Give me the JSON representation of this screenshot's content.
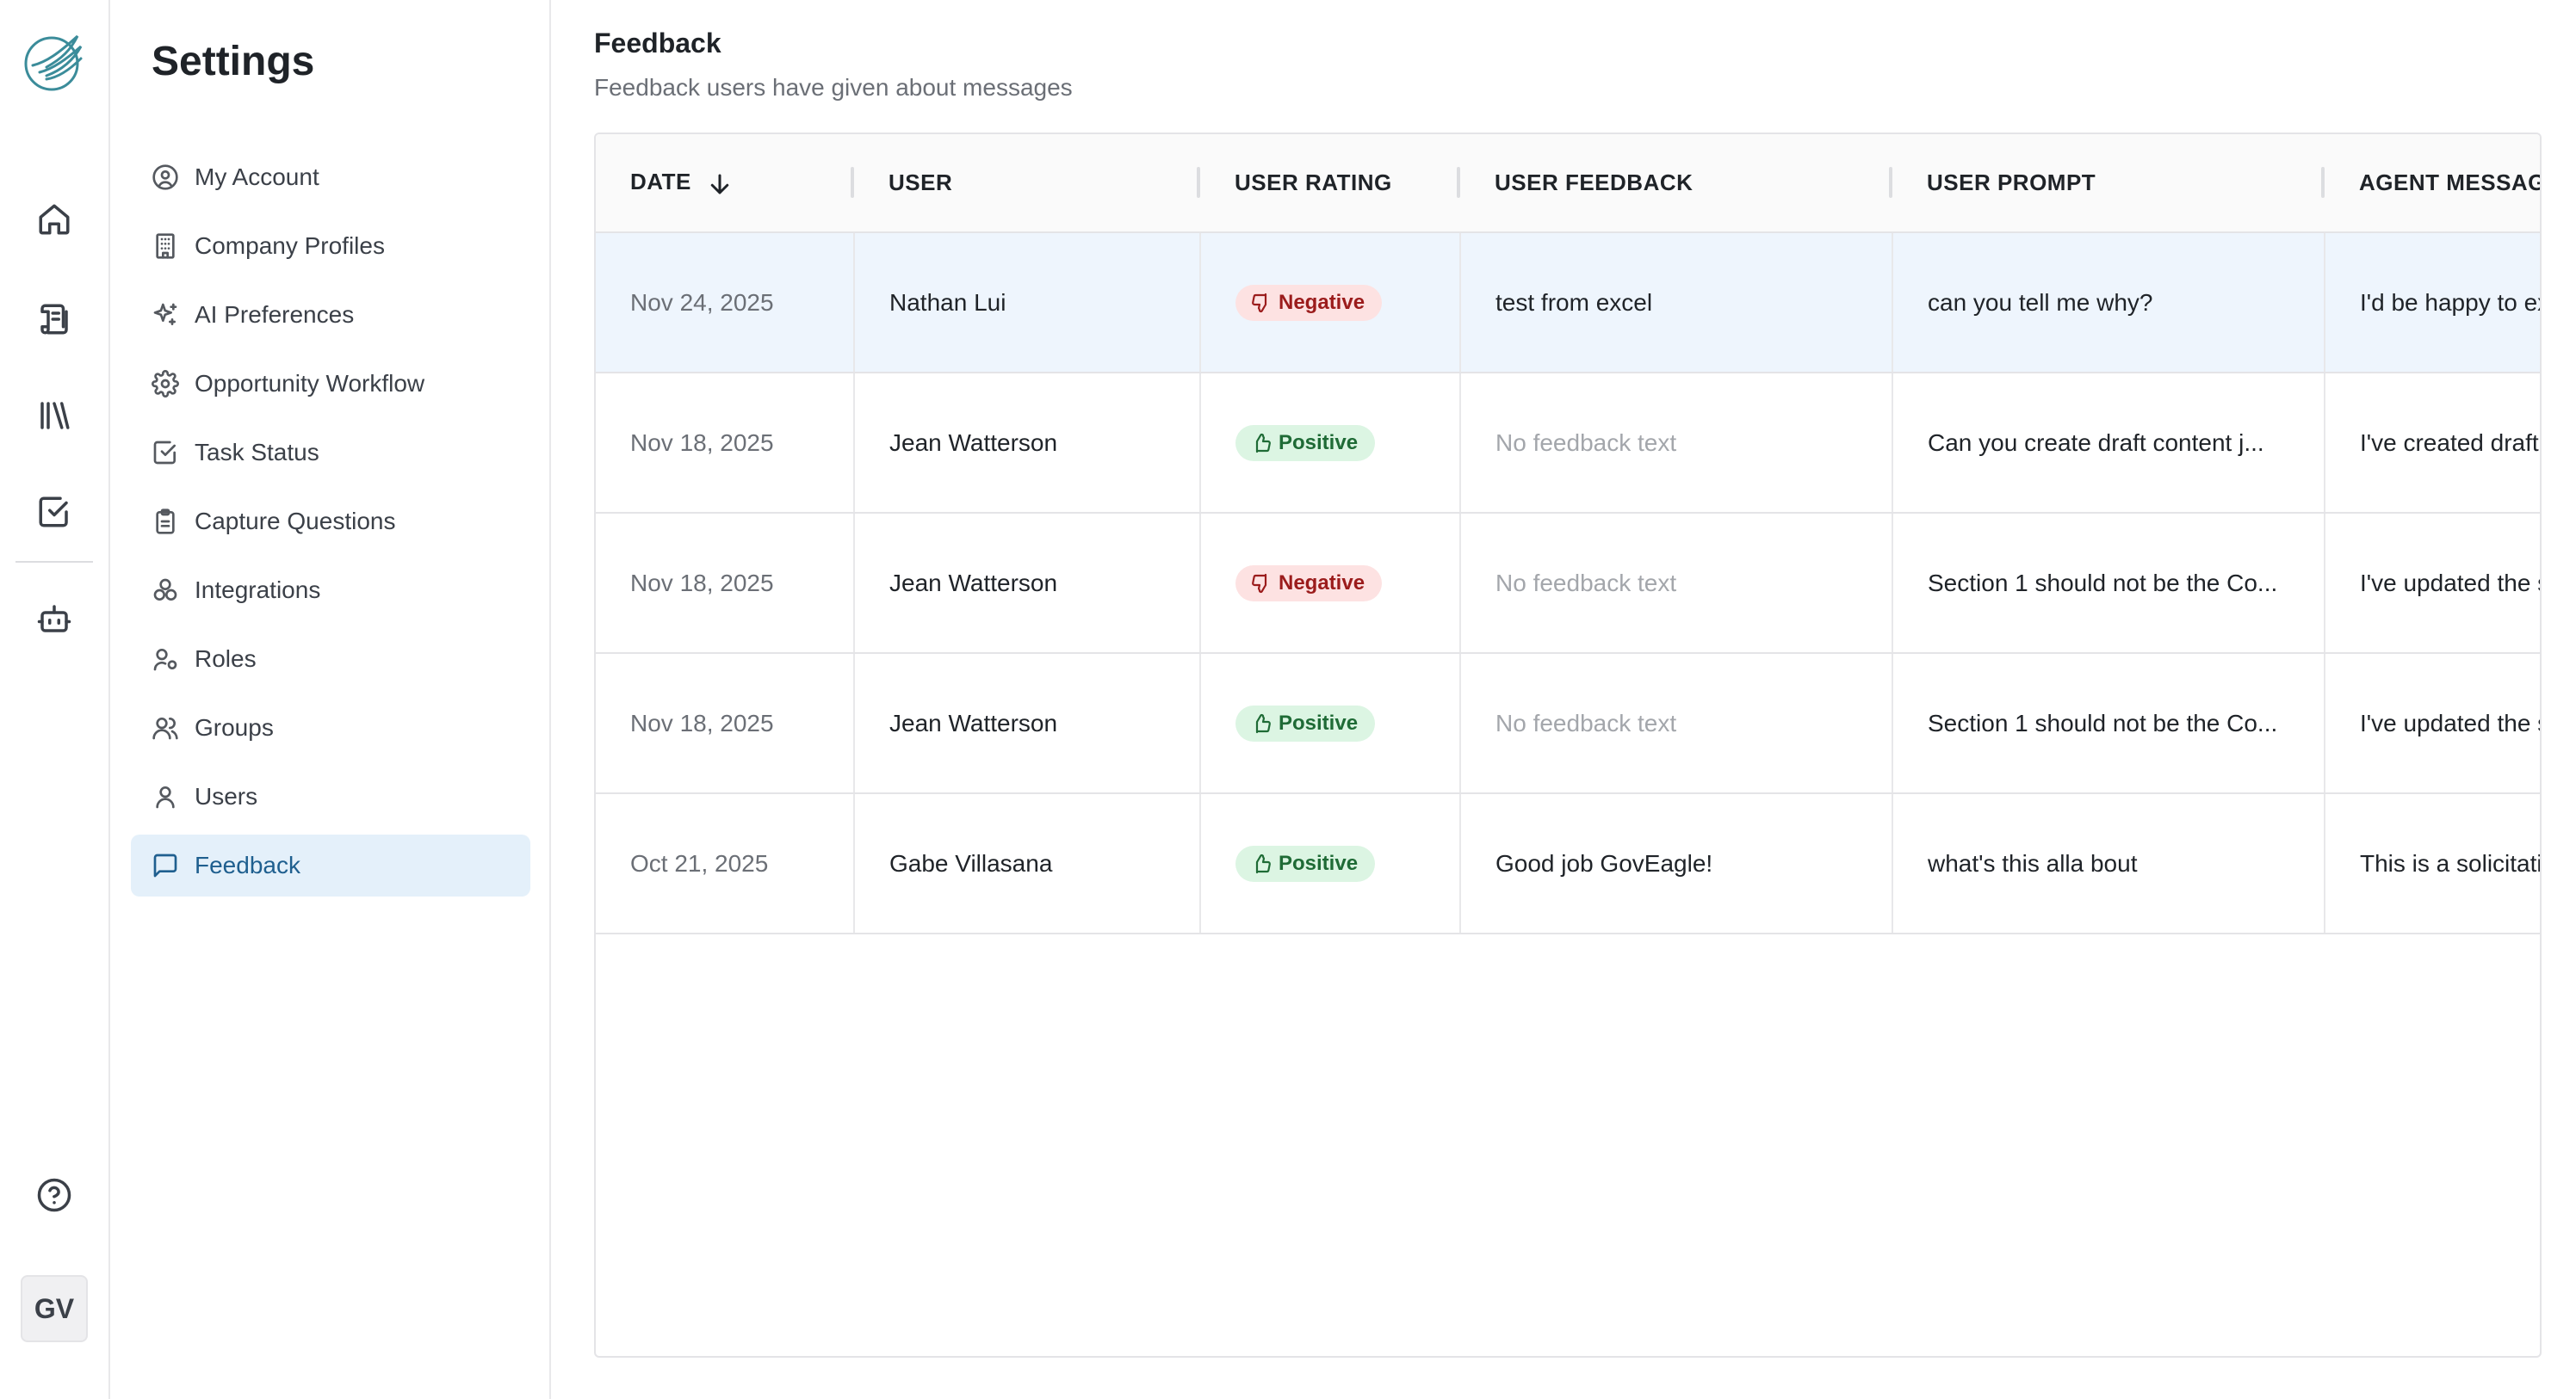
{
  "app": {
    "avatar_initials": "GV"
  },
  "rail": {
    "items": [
      {
        "icon": "home-icon"
      },
      {
        "icon": "scroll-icon"
      },
      {
        "icon": "library-icon"
      },
      {
        "icon": "checkbox-icon"
      },
      {
        "icon": "bot-icon"
      }
    ],
    "help_icon": "help-circle-icon"
  },
  "sidebar": {
    "title": "Settings",
    "items": [
      {
        "label": "My Account",
        "icon": "user-circle-icon"
      },
      {
        "label": "Company Profiles",
        "icon": "building-icon"
      },
      {
        "label": "AI Preferences",
        "icon": "sparkles-icon"
      },
      {
        "label": "Opportunity Workflow",
        "icon": "gear-icon"
      },
      {
        "label": "Task Status",
        "icon": "check-square-icon"
      },
      {
        "label": "Capture Questions",
        "icon": "clipboard-icon"
      },
      {
        "label": "Integrations",
        "icon": "blocks-icon"
      },
      {
        "label": "Roles",
        "icon": "user-key-icon"
      },
      {
        "label": "Groups",
        "icon": "users-icon"
      },
      {
        "label": "Users",
        "icon": "user-icon"
      },
      {
        "label": "Feedback",
        "icon": "message-square-icon",
        "active": true
      }
    ]
  },
  "page": {
    "title": "Feedback",
    "subtitle": "Feedback users have given about messages"
  },
  "table": {
    "columns": [
      "DATE",
      "USER",
      "USER RATING",
      "USER FEEDBACK",
      "USER PROMPT",
      "AGENT MESSAGE"
    ],
    "sort_column": "DATE",
    "sort_direction": "descending",
    "rows": [
      {
        "date": "Nov 24, 2025",
        "user": "Nathan Lui",
        "rating": "Negative",
        "feedback": "test from excel",
        "prompt": "can you tell me why?",
        "agent": "I'd be happy to explain",
        "selected": true
      },
      {
        "date": "Nov 18, 2025",
        "user": "Jean Watterson",
        "rating": "Positive",
        "feedback": "No feedback text",
        "prompt": "Can you create draft content j...",
        "agent": "I've created draft content"
      },
      {
        "date": "Nov 18, 2025",
        "user": "Jean Watterson",
        "rating": "Negative",
        "feedback": "No feedback text",
        "prompt": "Section 1 should not be the Co...",
        "agent": "I've updated the section"
      },
      {
        "date": "Nov 18, 2025",
        "user": "Jean Watterson",
        "rating": "Positive",
        "feedback": "No feedback text",
        "prompt": "Section 1 should not be the Co...",
        "agent": "I've updated the section"
      },
      {
        "date": "Oct 21, 2025",
        "user": "Gabe Villasana",
        "rating": "Positive",
        "feedback": "Good job GovEagle!",
        "prompt": "what's this alla bout",
        "agent": "This is a solicitation"
      }
    ],
    "empty_feedback_label": "No feedback text"
  },
  "colors": {
    "accent": "#1f5f8f",
    "active_bg": "#e4f0fa",
    "selected_row_bg": "#eef5fd",
    "negative_bg": "#fde2e2",
    "negative_fg": "#9b1c1c",
    "positive_bg": "#dcf5e3",
    "positive_fg": "#1f6b36"
  }
}
